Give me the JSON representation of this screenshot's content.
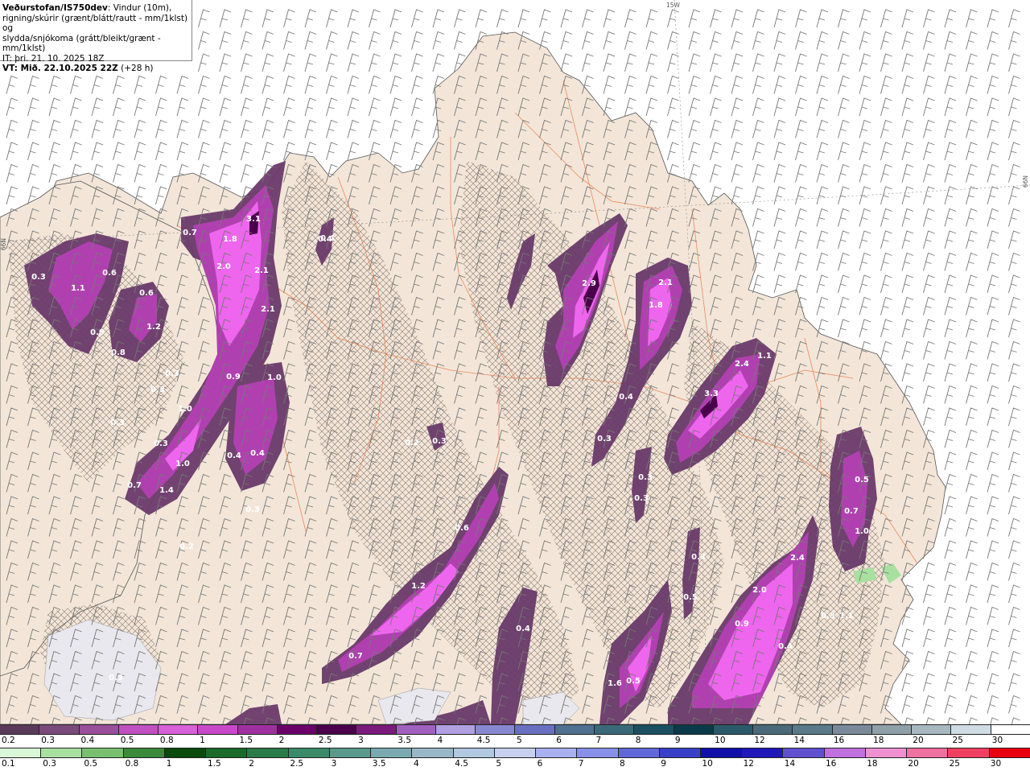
{
  "header": {
    "title_bold": "Veðurstofan/IS750dev",
    "title_rest": ": Vindur (10m),",
    "line2": "rigning/skúrir (grænt/blátt/rautt - mm/1klst) og",
    "line3": "slydda/snjókoma (grátt/bleikt/grænt - mm/1klst)",
    "it": "IT: þri. 21. 10. 2025 18Z",
    "vt": "VT: Mið. 22.10.2025 22Z",
    "vt_suffix": " (+28 h)"
  },
  "coords": {
    "top": "15W",
    "left": "66N",
    "right": "66N"
  },
  "map_labels": [
    "3.1",
    "1.8",
    "0.7",
    "2.0",
    "2.1",
    "2.1",
    "0.4",
    "0.3",
    "1.1",
    "0.6",
    "0.9",
    "0.6",
    "1.2",
    "0.8",
    "0.9",
    "1.0",
    "0.3",
    "0.3",
    "1.0",
    "0.3",
    "0.3",
    "1.0",
    "0.7",
    "1.4",
    "0.4",
    "0.4",
    "0.3",
    "0.2",
    "0.4",
    "2.9",
    "2.1",
    "1.8",
    "0.4",
    "0.3",
    "2.4",
    "3.3",
    "1.1",
    "0.2",
    "0.3",
    "0.6",
    "1.2",
    "0.7",
    "0.3",
    "0.4",
    "0.3",
    "0.3",
    "0.3",
    "0.5",
    "0.5",
    "0.7",
    "1.0",
    "2.4",
    "2.0",
    "0.9",
    "0.4",
    "0.3",
    "1.1",
    "1.6",
    "0.5"
  ],
  "legend_snow": {
    "labels": [
      "0.2",
      "0.3",
      "0.4",
      "0.5",
      "0.8",
      "1",
      "1.5",
      "2",
      "2.5",
      "3",
      "3.5",
      "4",
      "4.5",
      "5",
      "6",
      "7",
      "8",
      "9",
      "10",
      "12",
      "14",
      "16",
      "18",
      "20",
      "25",
      "30"
    ],
    "colors": [
      "#5a3a5a",
      "#7a4a7a",
      "#9a4f9a",
      "#c050c0",
      "#d860d8",
      "#c848c8",
      "#a030a0",
      "#6a006a",
      "#4a004a",
      "#7a1a7a",
      "#a060c0",
      "#b0a0e0",
      "#8888d0",
      "#6a70c0",
      "#507090",
      "#3a6a7a",
      "#1a5060",
      "#0a3a4a",
      "#2a5a6a",
      "#4a6a7a",
      "#5a7a8a",
      "#7a8a9a",
      "#90a0a8",
      "#a8b8c0",
      "#d0dce4",
      "#ffffff"
    ]
  },
  "legend_rain": {
    "labels": [
      "0.1",
      "0.3",
      "0.5",
      "0.8",
      "1",
      "1.5",
      "2",
      "2.5",
      "3",
      "3.5",
      "4",
      "4.5",
      "5",
      "6",
      "7",
      "8",
      "9",
      "10",
      "12",
      "14",
      "16",
      "18",
      "20",
      "25",
      "30"
    ],
    "colors": [
      "#d8f8d8",
      "#a8e0a0",
      "#78c070",
      "#3a8a3a",
      "#0a4a0a",
      "#1a6a2a",
      "#2a7a4a",
      "#3a8a6a",
      "#5a9a8a",
      "#7aaab0",
      "#98b8c8",
      "#b0c8e0",
      "#c8d0f0",
      "#a8b0f0",
      "#8890e8",
      "#6068d8",
      "#3840c8",
      "#1010a8",
      "#2018b8",
      "#6050d0",
      "#c070e0",
      "#f090d0",
      "#f070a0",
      "#f04060",
      "#e80010"
    ]
  },
  "colors": {
    "land": "#f3e6d8",
    "sea": "#ffffff",
    "road": "#e87848",
    "precip_light": "#6a3a6a",
    "precip_mid": "#b040b0",
    "precip_high": "#ee66ee"
  }
}
